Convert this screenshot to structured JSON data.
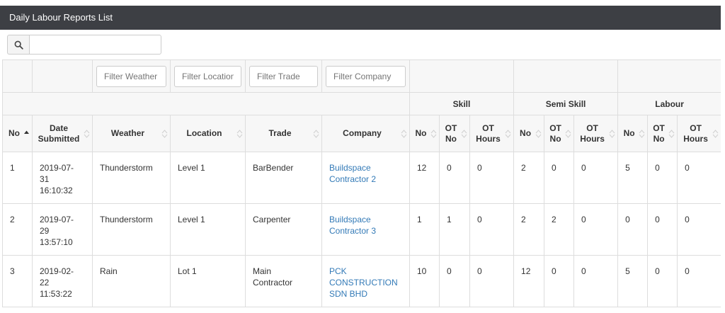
{
  "panel": {
    "title": "Daily Labour Reports List"
  },
  "search": {
    "value": ""
  },
  "filters": {
    "weather": "Filter Weather",
    "location": "Filter Location",
    "trade": "Filter Trade",
    "company": "Filter Company"
  },
  "groups": {
    "skill": "Skill",
    "semi_skill": "Semi Skill",
    "labour": "Labour"
  },
  "columns": {
    "no": "No",
    "date_submitted": [
      "Date",
      "Submitted"
    ],
    "weather": "Weather",
    "location": "Location",
    "trade": "Trade",
    "company": "Company",
    "sub_no": "No",
    "ot_no": [
      "OT",
      "No"
    ],
    "ot_hours": [
      "OT",
      "Hours"
    ]
  },
  "rows": [
    {
      "no": "1",
      "date": [
        "2019-07-",
        "31",
        "16:10:32"
      ],
      "weather": "Thunderstorm",
      "location": "Level 1",
      "trade": [
        "BarBender"
      ],
      "company": [
        "Buildspace",
        "Contractor 2"
      ],
      "skill": [
        "12",
        "0",
        "0"
      ],
      "semi_skill": [
        "2",
        "0",
        "0"
      ],
      "labour": [
        "5",
        "0",
        "0"
      ]
    },
    {
      "no": "2",
      "date": [
        "2019-07-",
        "29",
        "13:57:10"
      ],
      "weather": "Thunderstorm",
      "location": "Level 1",
      "trade": [
        "Carpenter"
      ],
      "company": [
        "Buildspace",
        "Contractor 3"
      ],
      "skill": [
        "1",
        "1",
        "0"
      ],
      "semi_skill": [
        "2",
        "2",
        "0"
      ],
      "labour": [
        "0",
        "0",
        "0"
      ]
    },
    {
      "no": "3",
      "date": [
        "2019-02-",
        "22",
        "11:53:22"
      ],
      "weather": "Rain",
      "location": "Lot 1",
      "trade": [
        "Main",
        "Contractor"
      ],
      "company": [
        "PCK",
        "CONSTRUCTION",
        "SDN BHD"
      ],
      "skill": [
        "10",
        "0",
        "0"
      ],
      "semi_skill": [
        "12",
        "0",
        "0"
      ],
      "labour": [
        "5",
        "0",
        "0"
      ]
    }
  ],
  "colors": {
    "header_bg": "#3d3f44",
    "link": "#337ab7",
    "header_row_bg": "#f7f7f7"
  },
  "icons": {
    "search": "search-icon",
    "sort": "sort-icon",
    "sort_asc": "sort-asc-icon"
  }
}
